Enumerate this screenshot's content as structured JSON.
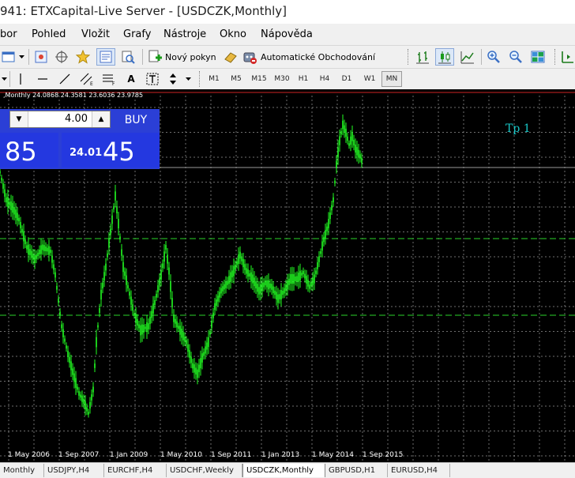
{
  "window": {
    "title": "941: ETXCapital-Live Server - [USDCZK,Monthly]"
  },
  "menu": [
    "bor",
    "Pohled",
    "Vložit",
    "Grafy",
    "Nástroje",
    "Okno",
    "Nápověda"
  ],
  "toolbar": {
    "new_order_label": "Nový pokyn",
    "auto_trading_label": "Automatické Obchodování"
  },
  "drawing_toolbar": {
    "text_tool_label": "A"
  },
  "timeframes": [
    {
      "label": "M1",
      "active": false
    },
    {
      "label": "M5",
      "active": false
    },
    {
      "label": "M15",
      "active": false
    },
    {
      "label": "M30",
      "active": false
    },
    {
      "label": "H1",
      "active": false
    },
    {
      "label": "H4",
      "active": false
    },
    {
      "label": "D1",
      "active": false
    },
    {
      "label": "W1",
      "active": false
    },
    {
      "label": "MN",
      "active": true
    }
  ],
  "chart": {
    "header": ",Monthly  24.0868 24.3581 23.6036 23.9785",
    "symbol": "USDCZK",
    "period": "Monthly",
    "text_label": "Tp 1",
    "colors": {
      "background": "#000000",
      "candle": "#22ff22",
      "grid": "#c8c8c8",
      "level_line": "#22aa22",
      "text_label": "#19c7c7"
    },
    "x_axis_labels": [
      "1 May 2006",
      "1 Sep 2007",
      "1 Jan 2009",
      "1 May 2010",
      "1 Sep 2011",
      "1 Jan 2013",
      "1 May 2014",
      "1 Sep 2015"
    ]
  },
  "one_click": {
    "lot_value": "4.00",
    "buy_label": "BUY",
    "sell_price_big": "85",
    "buy_price_small": "24.01",
    "buy_price_big": "45"
  },
  "tabs": [
    {
      "label": "Monthly",
      "active": false
    },
    {
      "label": "USDJPY,H4",
      "active": false
    },
    {
      "label": "EURCHF,H4",
      "active": false
    },
    {
      "label": "USDCHF,Weekly",
      "active": false
    },
    {
      "label": "USDCZK,Monthly",
      "active": true
    },
    {
      "label": "GBPUSD,H1",
      "active": false
    },
    {
      "label": "EURUSD,H4",
      "active": false
    }
  ]
}
